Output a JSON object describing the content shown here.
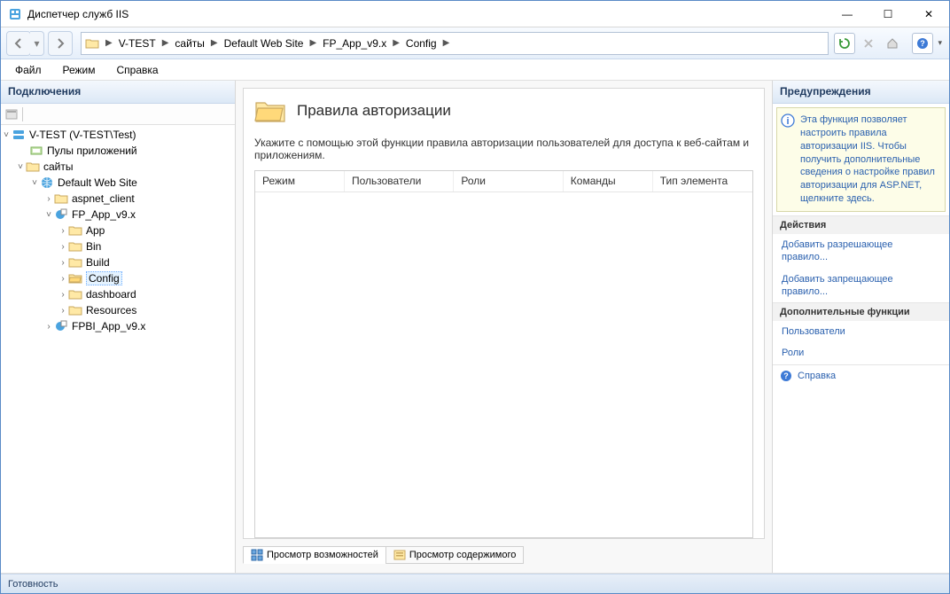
{
  "window": {
    "title": "Диспетчер служб IIS",
    "buttons": {
      "min": "—",
      "max": "☐",
      "close": "✕"
    }
  },
  "breadcrumb": [
    "V-TEST",
    "сайты",
    "Default Web Site",
    "FP_App_v9.x",
    "Config"
  ],
  "menubar": [
    "Файл",
    "Режим",
    "Справка"
  ],
  "left": {
    "header": "Подключения",
    "tree": {
      "root": "V-TEST (V-TEST\\Test)",
      "pools": "Пулы приложений",
      "sites": "сайты",
      "dws": "Default Web Site",
      "aspnet": "aspnet_client",
      "app": "FP_App_v9.x",
      "children": [
        "App",
        "Bin",
        "Build",
        "Config",
        "dashboard",
        "Resources"
      ],
      "fpbi": "FPBI_App_v9.x"
    }
  },
  "center": {
    "title": "Правила авторизации",
    "subtitle": "Укажите с помощью этой функции правила авторизации пользователей для доступа к веб-сайтам и приложениям.",
    "columns": [
      "Режим",
      "Пользователи",
      "Роли",
      "Команды",
      "Тип элемента"
    ],
    "tabs": {
      "features": "Просмотр возможностей",
      "content": "Просмотр содержимого"
    }
  },
  "right": {
    "header_warn": "Предупреждения",
    "info": "Эта функция позволяет настроить правила авторизации IIS. Чтобы получить дополнительные сведения о настройке правил авторизации для ASP.NET, щелкните здесь.",
    "header_actions": "Действия",
    "allow": "Добавить разрешающее правило...",
    "deny": "Добавить запрещающее правило...",
    "header_extra": "Дополнительные функции",
    "users": "Пользователи",
    "roles": "Роли",
    "help": "Справка"
  },
  "status": "Готовность"
}
